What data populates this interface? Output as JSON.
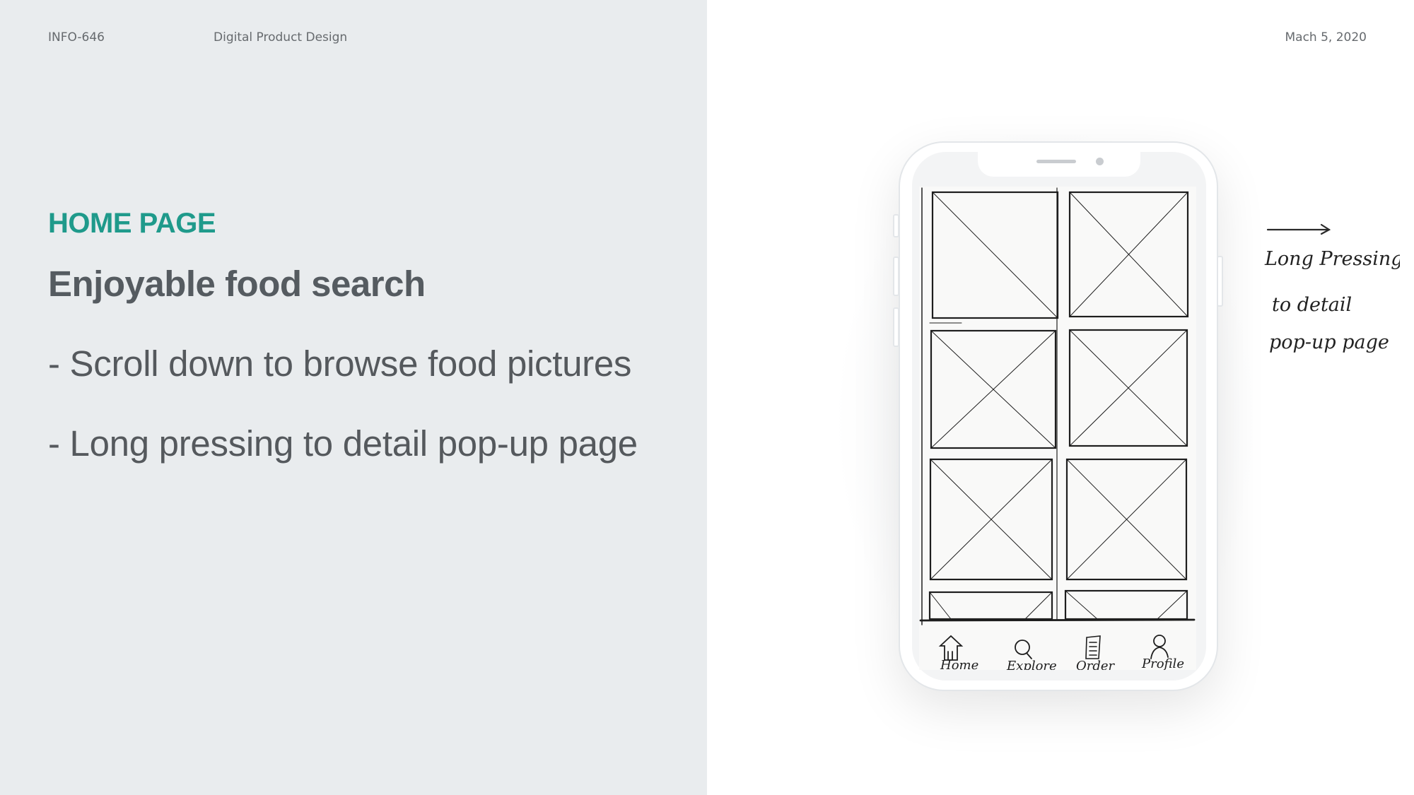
{
  "header": {
    "course_code": "INFO-646",
    "course_name": "Digital Product Design",
    "date": "Mach 5, 2020"
  },
  "content": {
    "section_label": "HOME PAGE",
    "headline": "Enjoyable food search",
    "bullets": [
      "- Scroll down to browse food pictures",
      "- Long pressing to detail pop-up page"
    ]
  },
  "sketch": {
    "tabs": [
      "Home",
      "Explore",
      "Order",
      "Profile"
    ],
    "handwritten_note": [
      "Long Pressing",
      "to detail",
      "pop-up page"
    ]
  },
  "colors": {
    "accent": "#1f9a8b",
    "left_background": "#e9ecee",
    "text_gray": "#555b60"
  }
}
